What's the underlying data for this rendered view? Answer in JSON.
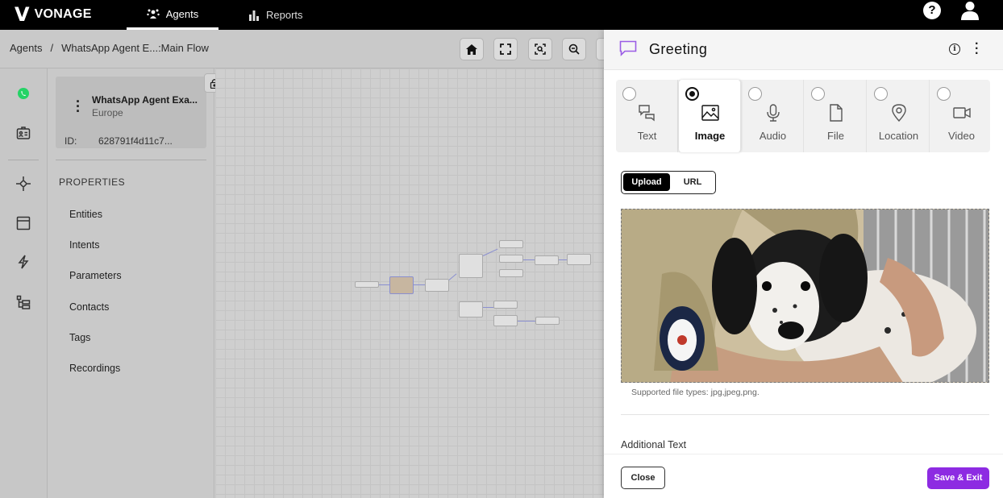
{
  "brand": {
    "mark": "V",
    "name": "VONAGE"
  },
  "nav": {
    "tabs": [
      {
        "label": "Agents",
        "icon": "agents-icon",
        "active": true
      },
      {
        "label": "Reports",
        "icon": "bar-chart-icon",
        "active": false
      }
    ],
    "help_icon": "?"
  },
  "breadcrumb": {
    "root": "Agents",
    "separator": "/",
    "current": "WhatsApp Agent E...:Main Flow"
  },
  "agent": {
    "name": "WhatsApp Agent Exa...",
    "region": "Europe",
    "id_label": "ID:",
    "id_value": "628791f4d11c7..."
  },
  "properties": {
    "title": "PROPERTIES",
    "items": [
      "Entities",
      "Intents",
      "Parameters",
      "Contacts",
      "Tags",
      "Recordings"
    ]
  },
  "panel": {
    "title": "Greeting",
    "message_types": [
      {
        "label": "Text",
        "icon": "chat-bubbles-icon",
        "selected": false
      },
      {
        "label": "Image",
        "icon": "image-icon",
        "selected": true
      },
      {
        "label": "Audio",
        "icon": "microphone-icon",
        "selected": false
      },
      {
        "label": "File",
        "icon": "file-icon",
        "selected": false
      },
      {
        "label": "Location",
        "icon": "location-pin-icon",
        "selected": false
      },
      {
        "label": "Video",
        "icon": "video-camera-icon",
        "selected": false
      }
    ],
    "source_toggle": {
      "upload": "Upload",
      "url": "URL",
      "selected": "Upload"
    },
    "supported_types": "Supported file types: jpg,jpeg,png.",
    "additional_text_label": "Additional Text",
    "close_label": "Close",
    "save_label": "Save & Exit"
  },
  "colors": {
    "accent": "#8d2be2",
    "topbar": "#000000",
    "whatsapp": "#25d366"
  }
}
